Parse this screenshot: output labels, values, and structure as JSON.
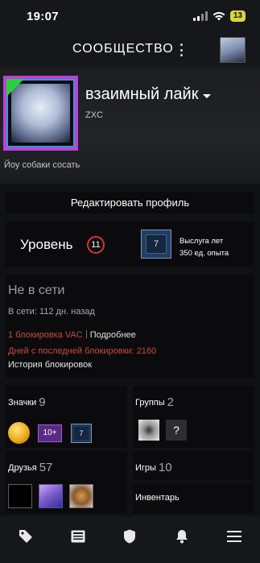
{
  "statusbar": {
    "time": "19:07",
    "battery": "13"
  },
  "appbar": {
    "title": "СООБЩЕСТВО"
  },
  "profile": {
    "name": "взаимный лайк",
    "real_name": "ZXC",
    "summary": "Йоу собаки сосать"
  },
  "edit_profile_label": "Редактировать профиль",
  "level": {
    "label": "Уровень",
    "value": "11",
    "years_badge_value": "7",
    "years_title": "Выслуга лет",
    "years_xp": "350 ед. опыта"
  },
  "status": {
    "title": "Не в сети",
    "last_online": "В сети: 112 дн. назад",
    "vac_bans": "1 блокировка VAC",
    "more": "Подробнее",
    "days_since_ban": "Дней с последней блокировки: 2160",
    "ban_history": "История блокировок"
  },
  "badges": {
    "label": "Значки",
    "count": "9",
    "items": [
      "coin",
      "10+",
      "7"
    ]
  },
  "groups": {
    "label": "Группы",
    "count": "2",
    "items": [
      "group-1",
      "?"
    ]
  },
  "friends": {
    "label": "Друзья",
    "count": "57"
  },
  "games": {
    "label": "Игры",
    "count": "10"
  },
  "inventory": {
    "label": "Инвентарь"
  },
  "tabbar": {
    "items": [
      "store-tag-icon",
      "news-icon",
      "shield-icon",
      "bell-icon",
      "menu-icon"
    ]
  },
  "colors": {
    "accent_ban": "#c64b3b",
    "level_ring": "#d8313c",
    "avatar_frame": "#c23fd7",
    "background": "#101114",
    "card": "#0b0b0d"
  }
}
